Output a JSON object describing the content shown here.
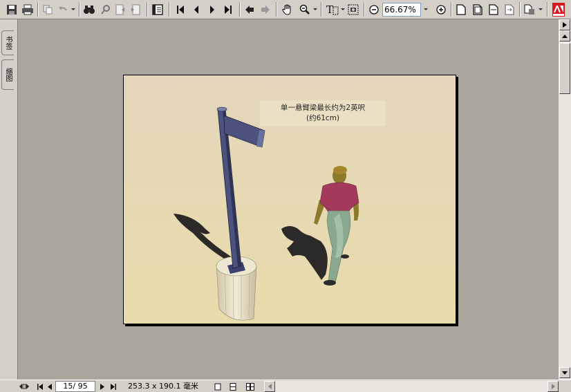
{
  "toolbar": {
    "zoom_value": "66.67%",
    "icons": [
      "save-icon",
      "print-icon",
      "copy-icon",
      "undo-icon",
      "find-icon",
      "search-icon",
      "fit-left-icon",
      "fit-right-icon",
      "navigation-pane-icon",
      "first-page-icon",
      "previous-page-icon",
      "next-page-icon",
      "last-page-icon",
      "go-back-icon",
      "go-forward-icon",
      "hand-tool-icon",
      "zoom-tool-icon",
      "select-text-tool-icon",
      "snapshot-icon",
      "zoom-out-icon",
      "zoom-in-icon",
      "actual-size-icon",
      "fit-page-icon",
      "fit-width-icon",
      "reflow-icon",
      "rotate-icon",
      "adobe-logo-icon"
    ]
  },
  "side_tabs": {
    "bookmarks": "书签",
    "thumbnails": "缩图"
  },
  "document": {
    "caption_line1": "单一悬臂梁最长约为2英呎",
    "caption_line2": "(约61cm)"
  },
  "status": {
    "page_indicator": "15/ 95",
    "page_size": "253.3 x 190.1 毫米"
  },
  "colors": {
    "toolbar_bg": "#d4d0c8",
    "viewer_bg": "#aaa69d",
    "page_gradient_top": "#e4d7b9",
    "page_gradient_bottom": "#e9dcaa",
    "pole": "#4a4f7a",
    "shirt": "#a33a5c",
    "pants": "#8aa88f"
  }
}
